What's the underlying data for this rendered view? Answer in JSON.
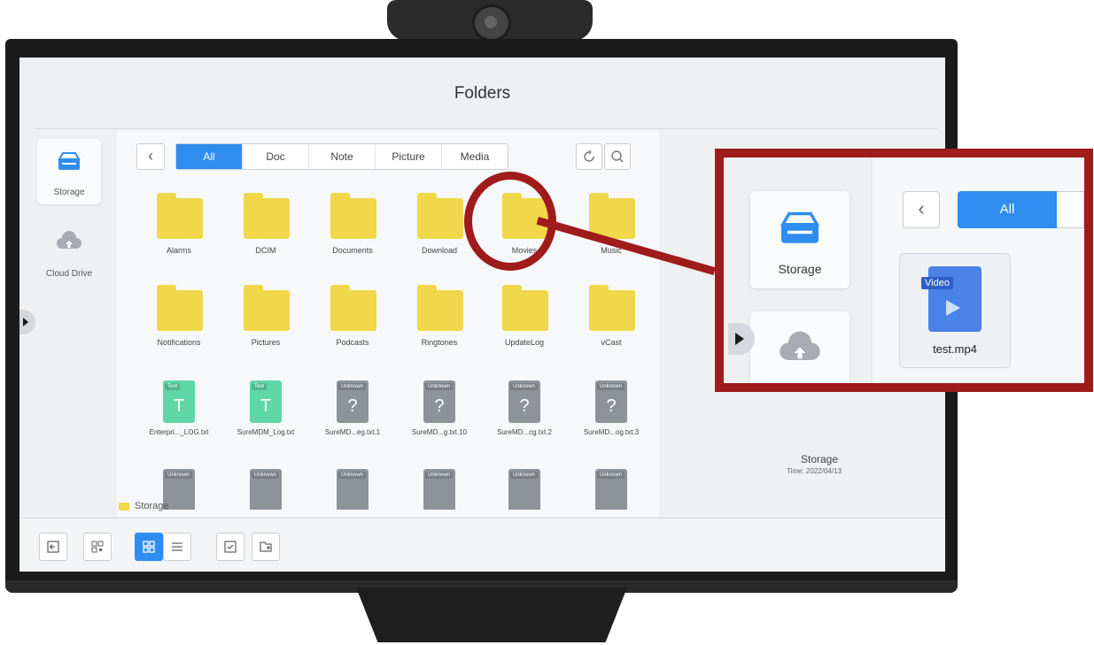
{
  "window": {
    "title": "Folders"
  },
  "sidebar": {
    "items": [
      {
        "label": "Storage",
        "icon": "storage-icon"
      },
      {
        "label": "Cloud Drive",
        "icon": "cloud-upload-icon"
      }
    ]
  },
  "toolbar": {
    "tabs": [
      {
        "label": "All"
      },
      {
        "label": "Doc"
      },
      {
        "label": "Note"
      },
      {
        "label": "Picture"
      },
      {
        "label": "Media"
      }
    ]
  },
  "folders": [
    {
      "name": "Alarms"
    },
    {
      "name": "DCIM"
    },
    {
      "name": "Documents"
    },
    {
      "name": "Download"
    },
    {
      "name": "Movies"
    },
    {
      "name": "Music"
    },
    {
      "name": "Notifications"
    },
    {
      "name": "Pictures"
    },
    {
      "name": "Podcasts"
    },
    {
      "name": "Ringtones"
    },
    {
      "name": "UpdateLog"
    },
    {
      "name": "vCast"
    }
  ],
  "files": [
    {
      "name": "Enterpri..._LOG.txt",
      "type": "Text"
    },
    {
      "name": "SureMDM_Log.txt",
      "type": "Text"
    },
    {
      "name": "SureMD...eg.txt.1",
      "type": "Unknown"
    },
    {
      "name": "SureMD...g.txt.10",
      "type": "Unknown"
    },
    {
      "name": "SureMD...cg.txt.2",
      "type": "Unknown"
    },
    {
      "name": "SureMD...og.txt.3",
      "type": "Unknown"
    }
  ],
  "extra_row": [
    {
      "type": "Unknown"
    },
    {
      "type": "Unknown"
    },
    {
      "type": "Unknown"
    },
    {
      "type": "Unknown"
    },
    {
      "type": "Unknown"
    },
    {
      "type": "Unknown"
    }
  ],
  "path": {
    "root": "Storage"
  },
  "details": {
    "title": "Storage",
    "time": "Time: 2022/04/13"
  },
  "inset": {
    "sidebar_label": "Storage",
    "tab_label": "All",
    "file": {
      "name": "test.mp4",
      "tag": "Video"
    }
  },
  "colors": {
    "accent": "#2f8df0",
    "folder": "#f0d84a",
    "highlight": "#a01b1b"
  }
}
